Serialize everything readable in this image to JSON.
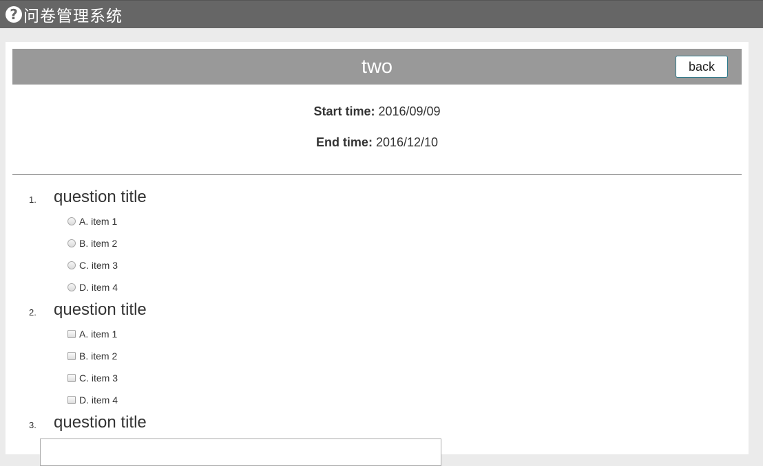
{
  "app": {
    "title": "问卷管理系统",
    "logo_icon": "question-circle-icon"
  },
  "survey": {
    "title": "two",
    "back_label": "back",
    "start_label": "Start time:",
    "start_value": "2016/09/09",
    "end_label": "End time:",
    "end_value": "2016/12/10"
  },
  "questions": [
    {
      "number": "1.",
      "title": "question title",
      "type": "radio",
      "options": [
        "A. item 1",
        "B. item 2",
        "C. item 3",
        "D. item 4"
      ]
    },
    {
      "number": "2.",
      "title": "question title",
      "type": "checkbox",
      "options": [
        "A. item 1",
        "B. item 2",
        "C. item 3",
        "D. item 4"
      ]
    },
    {
      "number": "3.",
      "title": "question title",
      "type": "text"
    }
  ],
  "colors": {
    "topbar": "#666666",
    "survey_header": "#999999",
    "background": "#ebebeb"
  }
}
